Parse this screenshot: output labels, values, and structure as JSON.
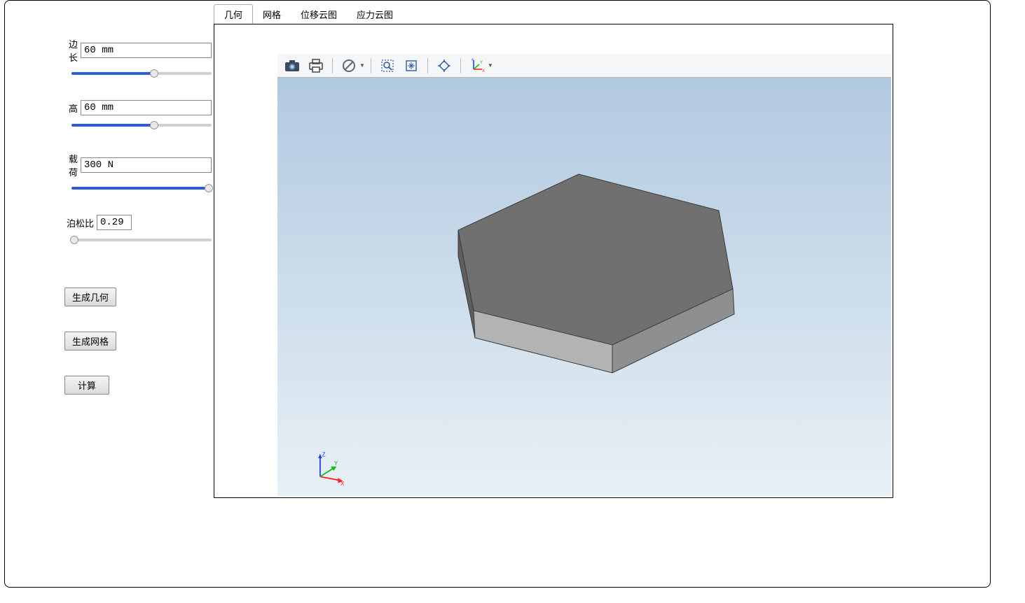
{
  "sidebar": {
    "params": [
      {
        "label": "边长",
        "value": "60 mm",
        "slider_pct": 59,
        "narrow": false
      },
      {
        "label": "高",
        "value": "60 mm",
        "slider_pct": 59,
        "narrow": false
      },
      {
        "label": "载荷",
        "value": "300 N",
        "slider_pct": 98,
        "narrow": false
      },
      {
        "label": "泊松比",
        "value": "0.29",
        "slider_pct": 2,
        "narrow": true
      }
    ],
    "buttons": {
      "gen_geom": "生成几何",
      "gen_mesh": "生成网格",
      "compute": "计算"
    }
  },
  "tabs": [
    {
      "label": "几何",
      "active": true
    },
    {
      "label": "网格",
      "active": false
    },
    {
      "label": "位移云图",
      "active": false
    },
    {
      "label": "应力云图",
      "active": false
    }
  ],
  "toolbar": {
    "camera": "camera-icon",
    "print": "print-icon",
    "deny": "deny-icon",
    "zoom_rect": "zoom-rect-icon",
    "fit": "fit-icon",
    "diamond": "diamond-icon",
    "axes": "axes-icon"
  },
  "axis_labels": {
    "x": "X",
    "y": "Y",
    "z": "Z"
  },
  "colors": {
    "model_top": "#707070",
    "model_front": "#b3b3b3",
    "model_side": "#8f8f8f",
    "axis_x": "#ff2020",
    "axis_y": "#10c010",
    "axis_z": "#2040ff"
  }
}
